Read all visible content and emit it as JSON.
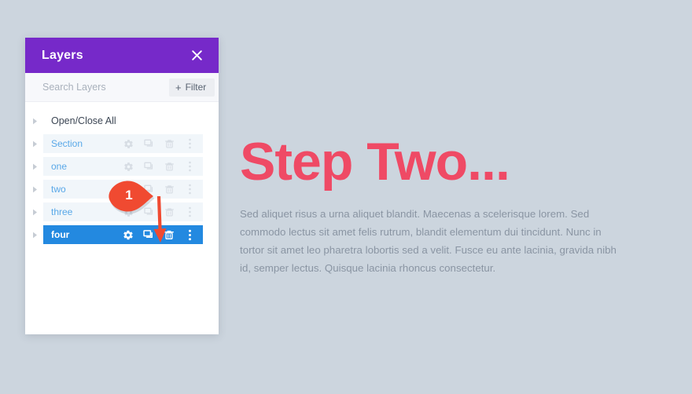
{
  "canvas": {
    "background_color": "#ccd5de"
  },
  "panel": {
    "title": "Layers",
    "header_color": "#7629c9",
    "close_icon": "close-icon",
    "search": {
      "placeholder": "Search Layers",
      "value": ""
    },
    "filter_button": {
      "label": "Filter",
      "plus_glyph": "+"
    },
    "open_close_all": {
      "label": "Open/Close All"
    },
    "row_icon_names": [
      "settings-gear-icon",
      "duplicate-icon",
      "trash-icon",
      "more-options-icon"
    ],
    "selected_color": "#2389e0",
    "label_color": "#59a8e8",
    "rows": [
      {
        "label": "Section",
        "selected": false
      },
      {
        "label": "one",
        "selected": false
      },
      {
        "label": "two",
        "selected": false
      },
      {
        "label": "three",
        "selected": false
      },
      {
        "label": "four",
        "selected": true
      }
    ]
  },
  "callout": {
    "number": "1",
    "color": "#f04a31"
  },
  "content": {
    "heading": "Step Two...",
    "heading_color": "#ef4a65",
    "paragraph": "Sed aliquet risus a urna aliquet blandit. Maecenas a scelerisque lorem. Sed commodo lectus sit amet felis rutrum, blandit elementum dui tincidunt. Nunc in tortor sit amet leo pharetra lobortis sed a velit. Fusce eu ante lacinia, gravida nibh id, semper lectus. Quisque lacinia rhoncus consectetur."
  }
}
